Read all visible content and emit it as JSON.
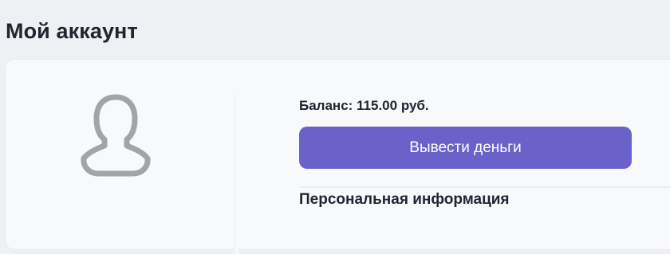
{
  "header": {
    "title": "Мой аккаунт"
  },
  "profile": {
    "avatar_icon": "user-silhouette-icon",
    "balance_text": "Баланс: 115.00 руб.",
    "withdraw_label": "Вывести деньги",
    "personal_info_title": "Персональная информация"
  },
  "colors": {
    "accent": "#6b62c9",
    "avatar_stroke": "#a3a3aa",
    "page_background": "#eef0f3",
    "card_background": "#f8f9fb"
  }
}
